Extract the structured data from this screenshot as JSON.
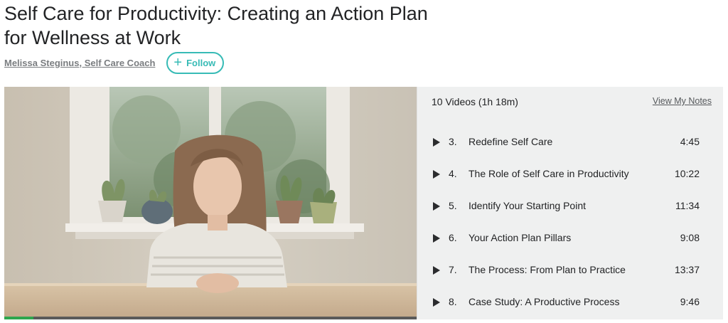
{
  "course": {
    "title": "Self Care for Productivity: Creating an Action Plan for Wellness at Work",
    "author": "Melissa Steginus, Self Care Coach",
    "follow_label": "Follow"
  },
  "video": {
    "progress_fraction": 0.07
  },
  "playlist": {
    "count_label": "10 Videos (1h 18m)",
    "view_notes_label": "View My Notes",
    "lessons": [
      {
        "number": "3.",
        "title": "Redefine Self Care",
        "duration": "4:45"
      },
      {
        "number": "4.",
        "title": "The Role of Self Care in Productivity",
        "duration": "10:22"
      },
      {
        "number": "5.",
        "title": "Identify Your Starting Point",
        "duration": "11:34"
      },
      {
        "number": "6.",
        "title": "Your Action Plan Pillars",
        "duration": "9:08"
      },
      {
        "number": "7.",
        "title": "The Process: From Plan to Practice",
        "duration": "13:37"
      },
      {
        "number": "8.",
        "title": "Case Study: A Productive Process",
        "duration": "9:46"
      }
    ]
  },
  "colors": {
    "accent": "#37bbb6",
    "progress": "#2fa64d",
    "sidebar_bg": "#eff0f0"
  },
  "icons": {
    "follow": "plus-icon",
    "lesson": "play-icon"
  }
}
